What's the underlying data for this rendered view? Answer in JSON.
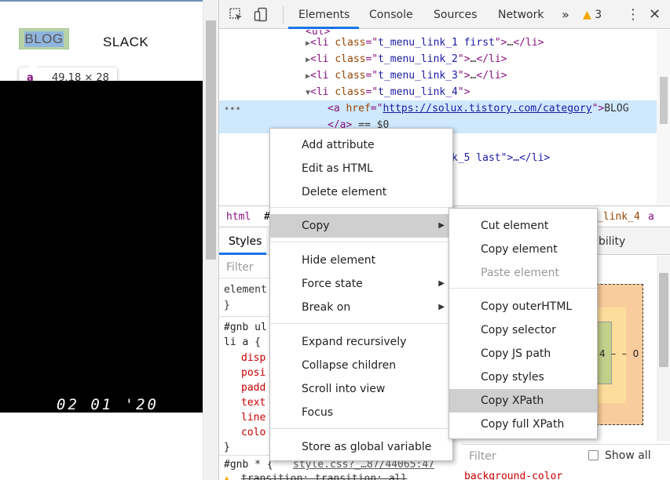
{
  "page": {
    "nav": [
      "BLOG",
      "SLACK"
    ],
    "tooltip": {
      "tag": "a",
      "size": "49.18 × 28"
    },
    "date_stamp": "02 01 '20"
  },
  "devtools": {
    "tabs": [
      "Elements",
      "Console",
      "Sources",
      "Network"
    ],
    "more_tabs": "»",
    "warnings": "3",
    "tree": {
      "line1": {
        "cls": "t_menu_link_1 first"
      },
      "line2": {
        "cls": "t_menu_link_2"
      },
      "line3": {
        "cls": "t_menu_link_3"
      },
      "line4": {
        "cls": "t_menu_link_4"
      },
      "line5": {
        "href": "https://solux.tistory.com/category",
        "text": "BLOG"
      },
      "line6": {
        "suffix": "== $0"
      },
      "line8": {
        "partial": "k_5 last\">…</li>"
      }
    },
    "crumbs": {
      "first": "html",
      "hash": "#",
      "last": "_link_4",
      "a": "a"
    },
    "styles": {
      "tab": "Styles",
      "accessibility_partial": "bility",
      "filter_placeholder": "Filter",
      "element_rule": "element",
      "rule1_selector_1": "#gnb ul",
      "rule1_selector_2": "li a {",
      "props": [
        "disp",
        "posi",
        "padd",
        "text",
        "line",
        "colo"
      ],
      "rule2_selector": "#gnb * {",
      "rule2_source": "style.css?_…87/44065:47",
      "rule2_prop": "transition: transition: all"
    },
    "box_model": {
      "left": "4",
      "dash": "–",
      "dash2": "–",
      "zero": "0"
    },
    "computed": {
      "filter_placeholder": "Filter",
      "show_all": "Show all",
      "bg_color": "background-color"
    }
  },
  "context_menu": {
    "items": [
      "Add attribute",
      "Edit as HTML",
      "Delete element",
      "Copy",
      "Hide element",
      "Force state",
      "Break on",
      "Expand recursively",
      "Collapse children",
      "Scroll into view",
      "Focus",
      "Store as global variable"
    ]
  },
  "copy_submenu": {
    "items": [
      "Cut element",
      "Copy element",
      "Paste element",
      "Copy outerHTML",
      "Copy selector",
      "Copy JS path",
      "Copy styles",
      "Copy XPath",
      "Copy full XPath"
    ]
  }
}
